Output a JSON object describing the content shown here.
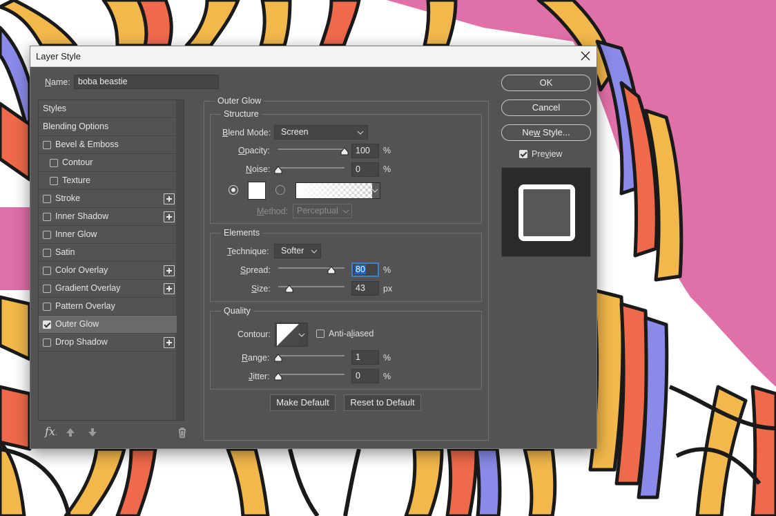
{
  "window": {
    "title": "Layer Style"
  },
  "name_field": {
    "label": "Name:",
    "value": "boba beastie"
  },
  "style_list": {
    "items": [
      {
        "label": "Styles",
        "checkbox": false,
        "indent": 0,
        "plus": false,
        "checked": false
      },
      {
        "label": "Blending Options",
        "checkbox": false,
        "indent": 0,
        "plus": false,
        "checked": false
      },
      {
        "label": "Bevel & Emboss",
        "checkbox": true,
        "indent": 0,
        "plus": false,
        "checked": false
      },
      {
        "label": "Contour",
        "checkbox": true,
        "indent": 1,
        "plus": false,
        "checked": false
      },
      {
        "label": "Texture",
        "checkbox": true,
        "indent": 1,
        "plus": false,
        "checked": false
      },
      {
        "label": "Stroke",
        "checkbox": true,
        "indent": 0,
        "plus": true,
        "checked": false
      },
      {
        "label": "Inner Shadow",
        "checkbox": true,
        "indent": 0,
        "plus": true,
        "checked": false
      },
      {
        "label": "Inner Glow",
        "checkbox": true,
        "indent": 0,
        "plus": false,
        "checked": false
      },
      {
        "label": "Satin",
        "checkbox": true,
        "indent": 0,
        "plus": false,
        "checked": false
      },
      {
        "label": "Color Overlay",
        "checkbox": true,
        "indent": 0,
        "plus": true,
        "checked": false
      },
      {
        "label": "Gradient Overlay",
        "checkbox": true,
        "indent": 0,
        "plus": true,
        "checked": false
      },
      {
        "label": "Pattern Overlay",
        "checkbox": true,
        "indent": 0,
        "plus": false,
        "checked": false
      },
      {
        "label": "Outer Glow",
        "checkbox": true,
        "indent": 0,
        "plus": false,
        "checked": true,
        "active": true
      },
      {
        "label": "Drop Shadow",
        "checkbox": true,
        "indent": 0,
        "plus": true,
        "checked": false
      }
    ],
    "footer_icons": [
      "fx-icon",
      "move-up-icon",
      "move-down-icon",
      "trash-icon"
    ]
  },
  "panel": {
    "title": "Outer Glow",
    "structure": {
      "title": "Structure",
      "blend_mode": {
        "label": "Blend Mode:",
        "value": "Screen"
      },
      "opacity": {
        "label": "Opacity:",
        "value": "100",
        "unit": "%",
        "level": 1.0
      },
      "noise": {
        "label": "Noise:",
        "value": "0",
        "unit": "%",
        "level": 0.0
      },
      "color_swatch": "#ffffff",
      "method": {
        "label": "Method:",
        "value": "Perceptual"
      }
    },
    "elements": {
      "title": "Elements",
      "technique": {
        "label": "Technique:",
        "value": "Softer"
      },
      "spread": {
        "label": "Spread:",
        "value": "80",
        "unit": "%",
        "level": 0.8
      },
      "size": {
        "label": "Size:",
        "value": "43",
        "unit": "px",
        "level": 0.17
      }
    },
    "quality": {
      "title": "Quality",
      "contour": {
        "label": "Contour:"
      },
      "anti_aliased": {
        "label": "Anti-aliased",
        "checked": false
      },
      "range": {
        "label": "Range:",
        "value": "1",
        "unit": "%",
        "level": 0.0
      },
      "jitter": {
        "label": "Jitter:",
        "value": "0",
        "unit": "%",
        "level": 0.0
      }
    },
    "make_default": "Make Default",
    "reset_default": "Reset to Default"
  },
  "buttons": {
    "ok": "OK",
    "cancel": "Cancel",
    "new_style": "New Style..."
  },
  "preview": {
    "label": "Preview",
    "checked": true
  },
  "colors": {
    "pink_bg": "#e070a8",
    "dialog_bg": "#535353",
    "accent": "#1c65c7"
  }
}
